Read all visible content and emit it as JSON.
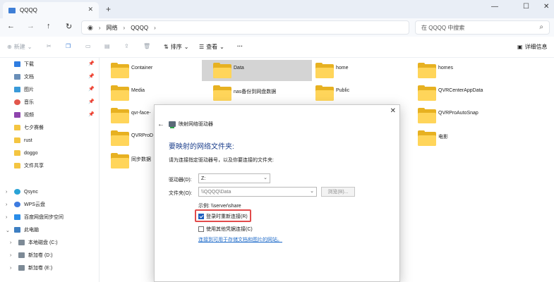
{
  "window": {
    "tab_title": "QQQQ",
    "new_tab": "+",
    "controls": {
      "minimize": "—",
      "maximize": "☐",
      "close": "✕"
    }
  },
  "address": {
    "breadcrumb": [
      "网络",
      "QQQQ"
    ],
    "search_placeholder": "在 QQQQ 中搜索"
  },
  "toolbar": {
    "new_label": "新建",
    "sort_label": "排序",
    "view_label": "查看",
    "more_label": "···",
    "details_label": "详细信息"
  },
  "sidebar": {
    "quick_access": [
      {
        "label": "下载",
        "icon": "download-icon",
        "pinned": true
      },
      {
        "label": "文档",
        "icon": "document-icon",
        "pinned": true
      },
      {
        "label": "图片",
        "icon": "picture-icon",
        "pinned": true
      },
      {
        "label": "音乐",
        "icon": "music-icon",
        "pinned": true
      },
      {
        "label": "视频",
        "icon": "video-icon",
        "pinned": true
      },
      {
        "label": "七夕赛餐",
        "icon": "folder-icon",
        "pinned": false
      },
      {
        "label": "rust",
        "icon": "folder-icon",
        "pinned": false
      },
      {
        "label": "doggo",
        "icon": "folder-icon",
        "pinned": false
      },
      {
        "label": "文件共享",
        "icon": "folder-icon",
        "pinned": false
      }
    ],
    "locations": [
      {
        "label": "Qsync",
        "icon": "qsync-icon"
      },
      {
        "label": "WPS云盘",
        "icon": "cloud-icon"
      },
      {
        "label": "百度网盘同步空间",
        "icon": "baidu-icon"
      },
      {
        "label": "此电脑",
        "icon": "pc-icon"
      },
      {
        "label": "本地磁盘 (C:)",
        "icon": "drive-icon"
      },
      {
        "label": "新加卷 (D:)",
        "icon": "drive-icon"
      },
      {
        "label": "新加卷 (E:)",
        "icon": "drive-icon"
      }
    ]
  },
  "files": [
    "Container",
    "Data",
    "home",
    "homes",
    "Media",
    "nas备份到网盘数据",
    "Public",
    "QVRCenterAppData",
    "qvr-face-",
    "QVRProAutoSnap",
    "QVRProD",
    "电影",
    "同步数据"
  ],
  "dialog": {
    "title": "映射网络驱动器",
    "heading": "要映射的网络文件夹:",
    "description": "请为连接指定驱动器号，以及你要连接的文件夹:",
    "drive_label": "驱动器(D):",
    "drive_value": "Z:",
    "folder_label": "文件夹(O):",
    "folder_value": "\\\\QQQQ\\Data",
    "browse_label": "浏览(B)...",
    "example": "示例: \\\\server\\share",
    "reconnect_label": "登录时重新连接(R)",
    "reconnect_checked": true,
    "other_creds_label": "使用其他凭据连接(C)",
    "other_creds_checked": false,
    "link": "连接到可用于存储文档和图片的网站。",
    "close": "✕",
    "back": "←"
  }
}
